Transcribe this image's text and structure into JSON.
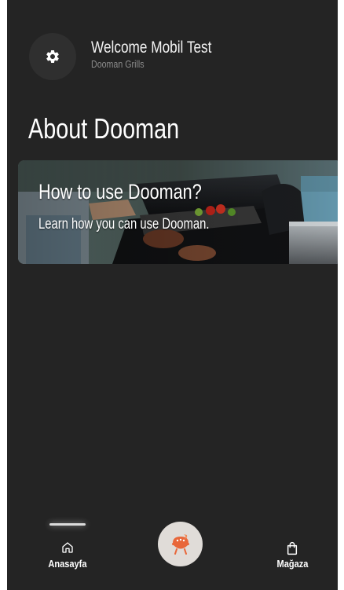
{
  "header": {
    "welcome_title": "Welcome Mobil Test",
    "subtitle": "Dooman Grills",
    "settings_icon": "gear-icon"
  },
  "page": {
    "title": "About Dooman"
  },
  "card": {
    "title": "How to use Dooman?",
    "subtitle": "Learn how you can use Dooman."
  },
  "bottom_nav": {
    "home_label": "Anasayfa",
    "home_icon": "home-icon",
    "store_label": "Mağaza",
    "store_icon": "shopping-bag-icon",
    "center_icon": "grill-logo-icon"
  },
  "colors": {
    "background": "#242424",
    "accent": "#e8673a",
    "text": "#ffffff",
    "muted": "#8c8c8c"
  }
}
